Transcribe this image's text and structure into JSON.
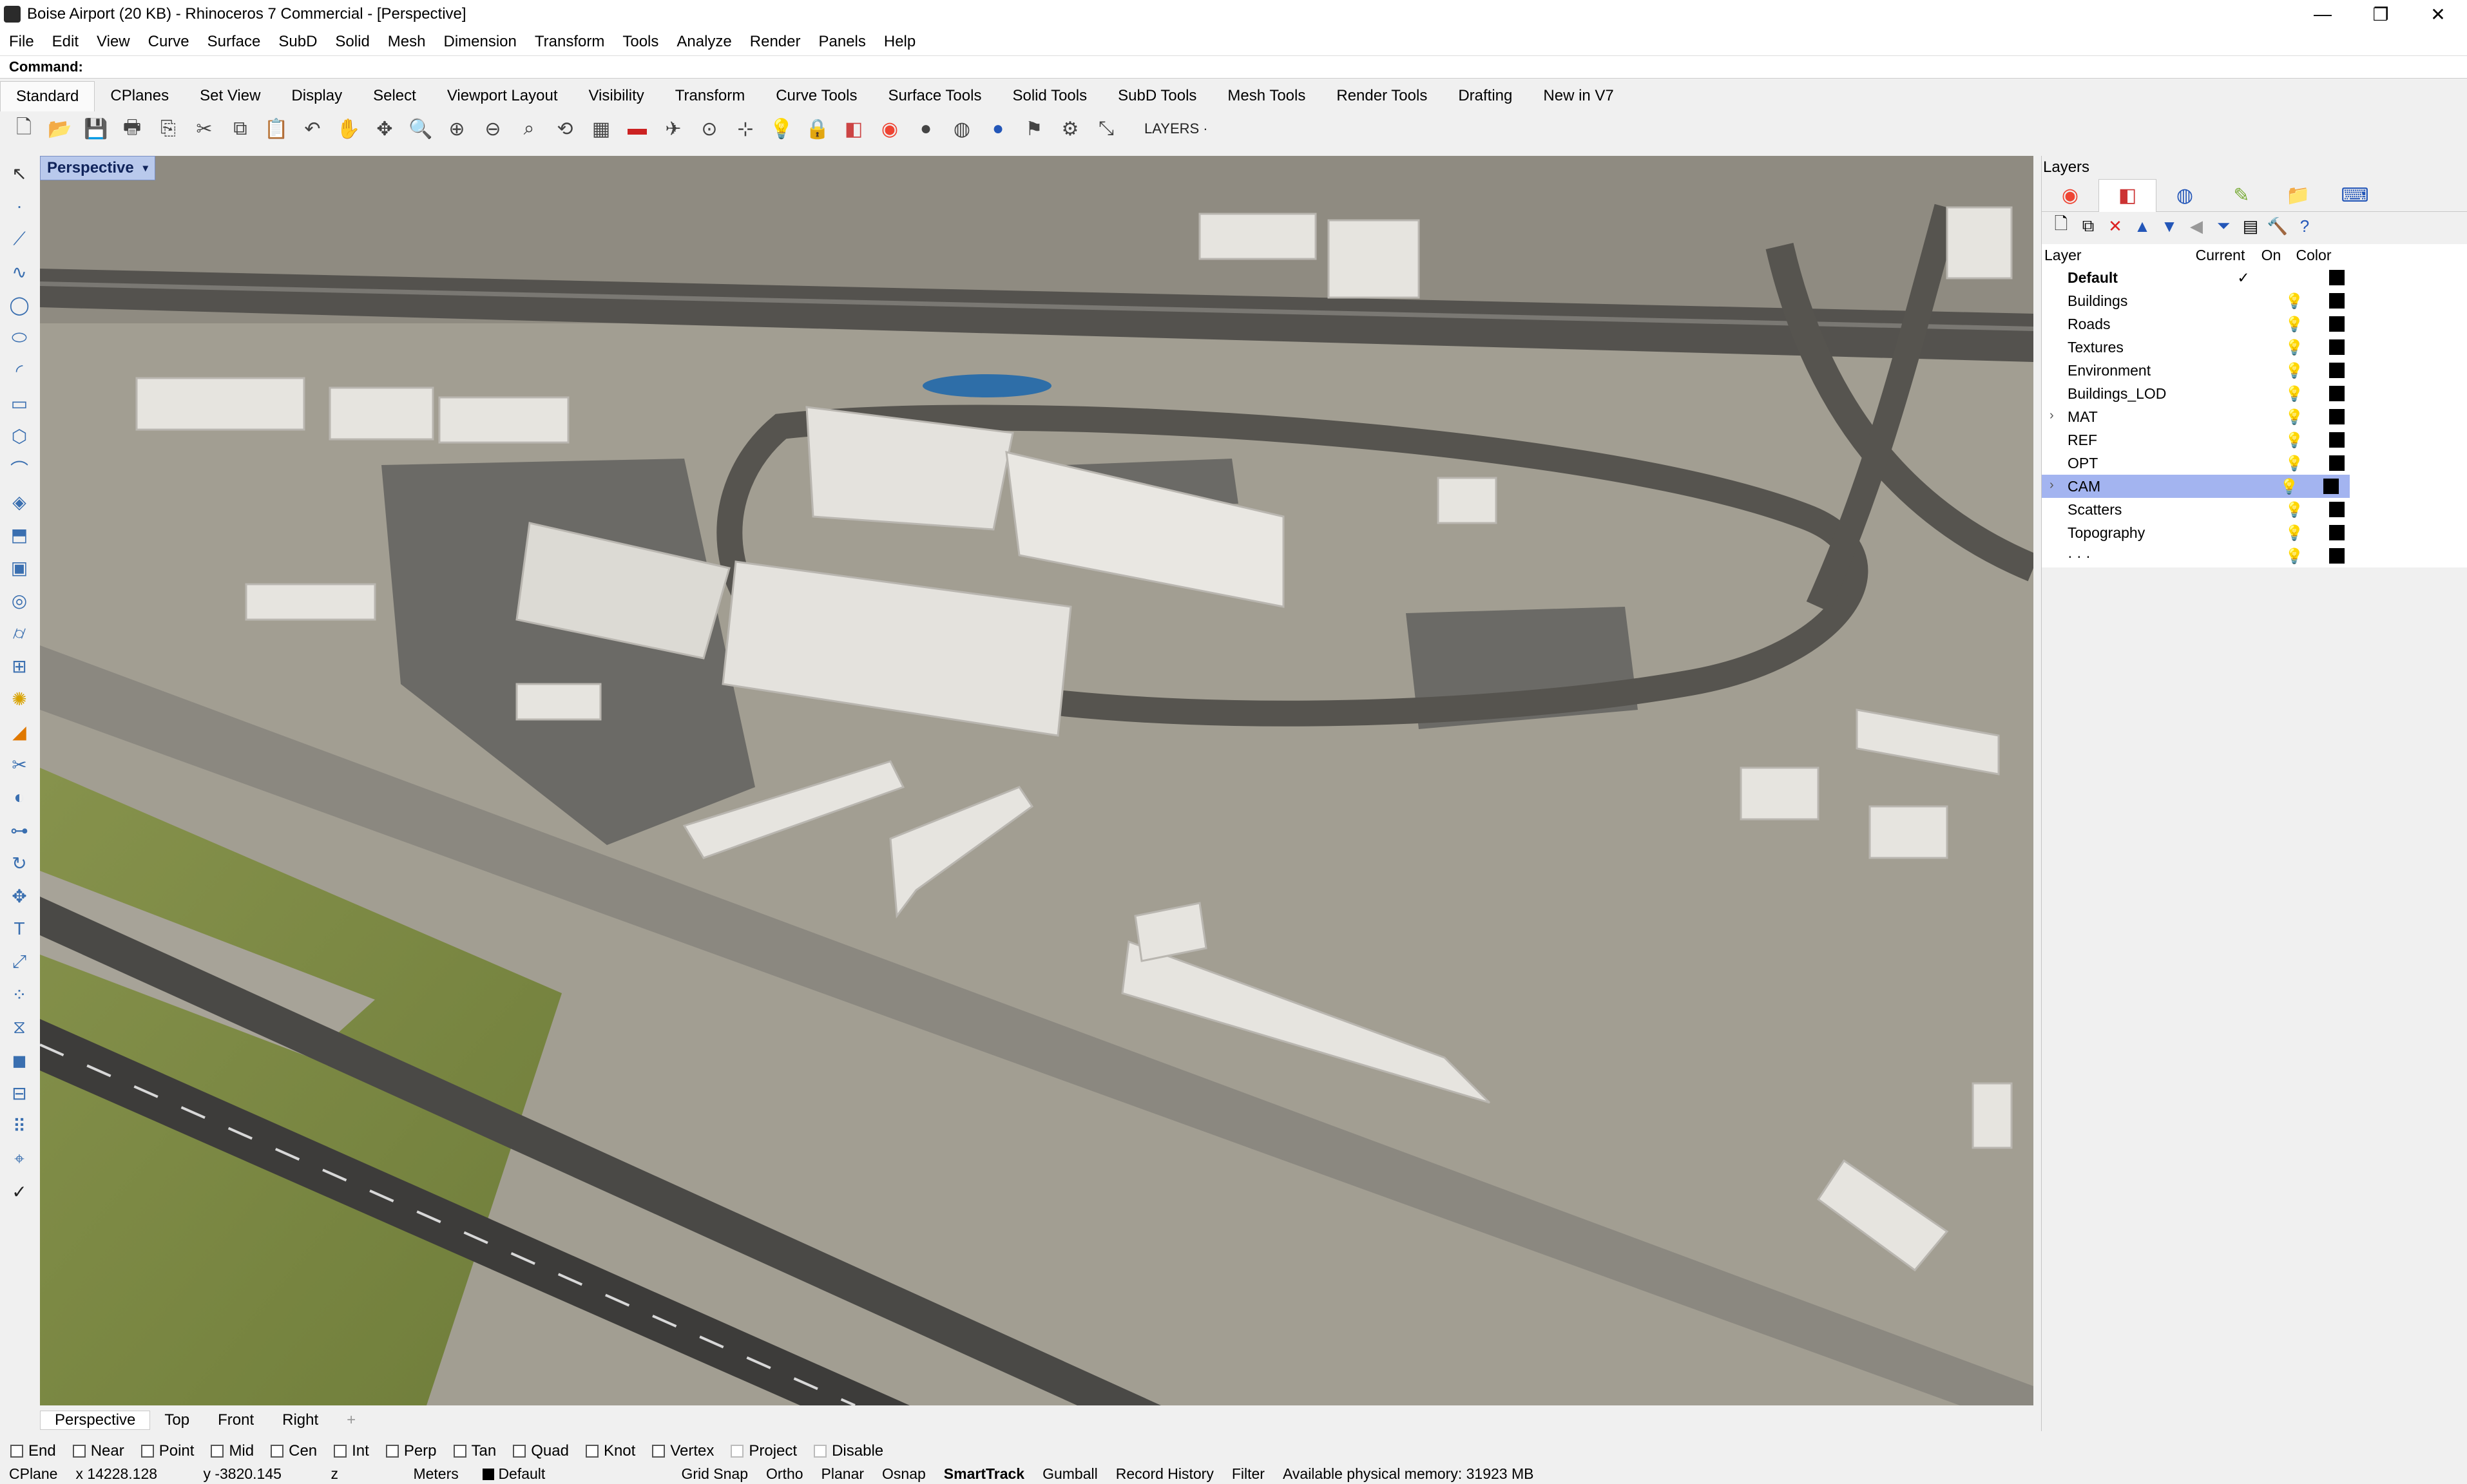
{
  "window": {
    "title": "Boise Airport (20 KB) - Rhinoceros 7 Commercial - [Perspective]",
    "buttons": {
      "minimize": "—",
      "maximize": "❐",
      "close": "✕"
    }
  },
  "menu": [
    "File",
    "Edit",
    "View",
    "Curve",
    "Surface",
    "SubD",
    "Solid",
    "Mesh",
    "Dimension",
    "Transform",
    "Tools",
    "Analyze",
    "Render",
    "Panels",
    "Help"
  ],
  "command": {
    "label": "Command:"
  },
  "toolbar_tabs": [
    "Standard",
    "CPlanes",
    "Set View",
    "Display",
    "Select",
    "Viewport Layout",
    "Visibility",
    "Transform",
    "Curve Tools",
    "Surface Tools",
    "Solid Tools",
    "SubD Tools",
    "Mesh Tools",
    "Render Tools",
    "Drafting",
    "New in V7"
  ],
  "toolbar": {
    "layers_label": "LAYERS ·"
  },
  "viewport": {
    "label": "Perspective",
    "caret": "▾"
  },
  "viewport_tabs": [
    "Perspective",
    "Top",
    "Front",
    "Right"
  ],
  "viewport_tab_add": "+",
  "osnaps": [
    "End",
    "Near",
    "Point",
    "Mid",
    "Cen",
    "Int",
    "Perp",
    "Tan",
    "Quad",
    "Knot",
    "Vertex",
    "Project",
    "Disable"
  ],
  "status": {
    "cplane": "CPlane",
    "x": "x 14228.128",
    "y": "y -3820.145",
    "z": "z",
    "units": "Meters",
    "layer": "Default",
    "grid_snap": "Grid Snap",
    "ortho": "Ortho",
    "planar": "Planar",
    "osnap": "Osnap",
    "smarttrack": "SmartTrack",
    "gumball": "Gumball",
    "record_history": "Record History",
    "filter": "Filter",
    "memory": "Available physical memory: 31923 MB"
  },
  "layers_panel": {
    "title": "Layers",
    "columns": {
      "layer": "Layer",
      "current": "Current",
      "on": "On",
      "color": "Color"
    },
    "rows": [
      {
        "name": "Default",
        "current": "✓",
        "bold": true
      },
      {
        "name": "Buildings"
      },
      {
        "name": "Roads"
      },
      {
        "name": "Textures"
      },
      {
        "name": "Environment"
      },
      {
        "name": "Buildings_LOD"
      },
      {
        "name": "MAT",
        "expandable": true
      },
      {
        "name": "REF"
      },
      {
        "name": "OPT"
      },
      {
        "name": "CAM",
        "expandable": true,
        "selected": true
      },
      {
        "name": "Scatters"
      },
      {
        "name": "Topography"
      },
      {
        "name": "· · ·"
      }
    ]
  },
  "colors": {
    "accent": "#a3b4f0",
    "viewport_label": "#b9c9ec",
    "bulb": "#e2b800",
    "ground": "#9b978c"
  }
}
